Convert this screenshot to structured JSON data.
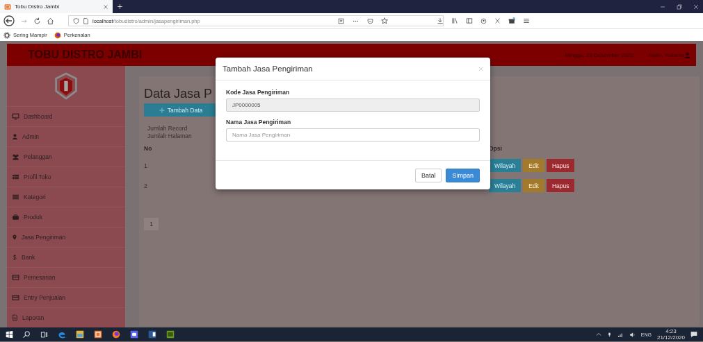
{
  "browser": {
    "tab_title": "Tobu Distro Jambi",
    "url_host": "localhost",
    "url_path": "/tobudistro/admin/jasapengiriman.php",
    "bookmarks": [
      {
        "label": "Sering Mampir",
        "kind": "gear"
      },
      {
        "label": "Perkenalan",
        "kind": "firefox"
      }
    ]
  },
  "header": {
    "brand": "TOBU DISTRO JAMBI",
    "date": "Minggu, 20 Desember 2020",
    "greeting": "Hallo, Yulianto"
  },
  "sidebar": {
    "items": [
      {
        "label": "Dashboard",
        "kind": "monitor"
      },
      {
        "label": "Admin",
        "kind": "user"
      },
      {
        "label": "Pelanggan",
        "kind": "users"
      },
      {
        "label": "Profil Toko",
        "kind": "grid"
      },
      {
        "label": "Kategori",
        "kind": "list"
      },
      {
        "label": "Produk",
        "kind": "briefcase"
      },
      {
        "label": "Jasa Pengiriman",
        "kind": "marker"
      },
      {
        "label": "Bank",
        "kind": "dollar"
      },
      {
        "label": "Pemesanan",
        "kind": "card"
      },
      {
        "label": "Entry Penjualan",
        "kind": "card"
      },
      {
        "label": "Laporan",
        "kind": "file"
      }
    ]
  },
  "page": {
    "title": "Data Jasa P",
    "add_button": "Tambah Data",
    "stats": [
      "Jumlah Record",
      "Jumlah Halaman"
    ],
    "table": {
      "columns": [
        "No",
        "Opsi"
      ],
      "rows": [
        {
          "no": "1",
          "actions": [
            {
              "label": "Wilayah",
              "kind": "info"
            },
            {
              "label": "Edit",
              "kind": "warning"
            },
            {
              "label": "Hapus",
              "kind": "danger"
            }
          ]
        },
        {
          "no": "2",
          "actions": [
            {
              "label": "Wilayah",
              "kind": "info"
            },
            {
              "label": "Edit",
              "kind": "warning"
            },
            {
              "label": "Hapus",
              "kind": "danger"
            }
          ]
        }
      ]
    },
    "pages": [
      "1"
    ]
  },
  "modal": {
    "title": "Tambah Jasa Pengiriman",
    "fields": [
      {
        "label": "Kode Jasa Pengiriman",
        "value": "JP0000005",
        "disabled": true
      },
      {
        "label": "Nama Jasa Pengiriman",
        "placeholder": "Nama Jasa Pengiriman",
        "disabled": false
      }
    ],
    "buttons": [
      {
        "label": "Batal",
        "kind": "default"
      },
      {
        "label": "Simpan",
        "kind": "primary"
      }
    ]
  },
  "taskbar": {
    "language": "ENG",
    "time": "4:23",
    "date": "21/12/2020"
  }
}
